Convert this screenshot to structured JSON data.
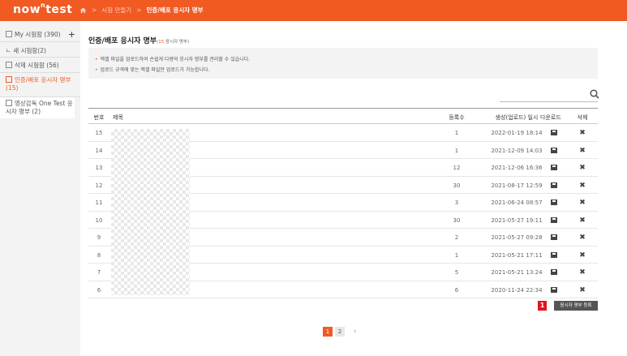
{
  "brand": {
    "logo_main": "now",
    "logo_sup": "n",
    "logo_tail": "test"
  },
  "breadcrumb": {
    "sep1": ">",
    "item1": "시험 만들기",
    "sep2": ">",
    "item2": "인증/배포 응시자 명부"
  },
  "sidebar": {
    "items": [
      {
        "label": "My 시험함 (390)"
      },
      {
        "label": "ㄴ 새 시험함(2)"
      },
      {
        "label": "삭제 시험함 (56)"
      },
      {
        "label": "인증/배포 응시자 명부 (15)"
      },
      {
        "label": "영상감독 One Test 응시자 명부 (2)"
      }
    ],
    "plus": "+"
  },
  "page": {
    "title": "인증/배포 응시자 명부",
    "title_count": "(15",
    "title_count_unit": " 응시자 명부)",
    "notices": [
      "엑셀 파일을 업로드하여 손쉽게 다량의 응시자 명부를 관리할 수 있습니다.",
      "업로드 규격에 맞는 엑셀 파일만 업로드가 가능합니다."
    ]
  },
  "table": {
    "headers": {
      "num": "번호",
      "title": "제목",
      "count": "등록수",
      "date": "생성(업로드) 일시",
      "download": "다운로드",
      "delete": "삭제"
    },
    "rows": [
      {
        "num": "15",
        "count": "1",
        "date": "2022-01-19 18:14"
      },
      {
        "num": "14",
        "count": "1",
        "date": "2021-12-09 14:03"
      },
      {
        "num": "13",
        "count": "12",
        "date": "2021-12-06 16:36"
      },
      {
        "num": "12",
        "count": "30",
        "date": "2021-08-17 12:59"
      },
      {
        "num": "11",
        "count": "3",
        "date": "2021-06-24 08:57"
      },
      {
        "num": "10",
        "count": "30",
        "date": "2021-05-27 19:11"
      },
      {
        "num": "9",
        "count": "2",
        "date": "2021-05-27 09:28"
      },
      {
        "num": "8",
        "count": "1",
        "date": "2021-05-21 17:11"
      },
      {
        "num": "7",
        "count": "5",
        "date": "2021-05-21 13:24"
      },
      {
        "num": "6",
        "count": "6",
        "date": "2020-11-24 22:34"
      }
    ]
  },
  "actions": {
    "badge": "1",
    "register_label": "응시자 명부 등록"
  },
  "pagination": {
    "pages": [
      "1",
      "2"
    ],
    "next": "›"
  },
  "colors": {
    "accent": "#f15a22",
    "badge": "#e3121b",
    "button": "#555555"
  }
}
